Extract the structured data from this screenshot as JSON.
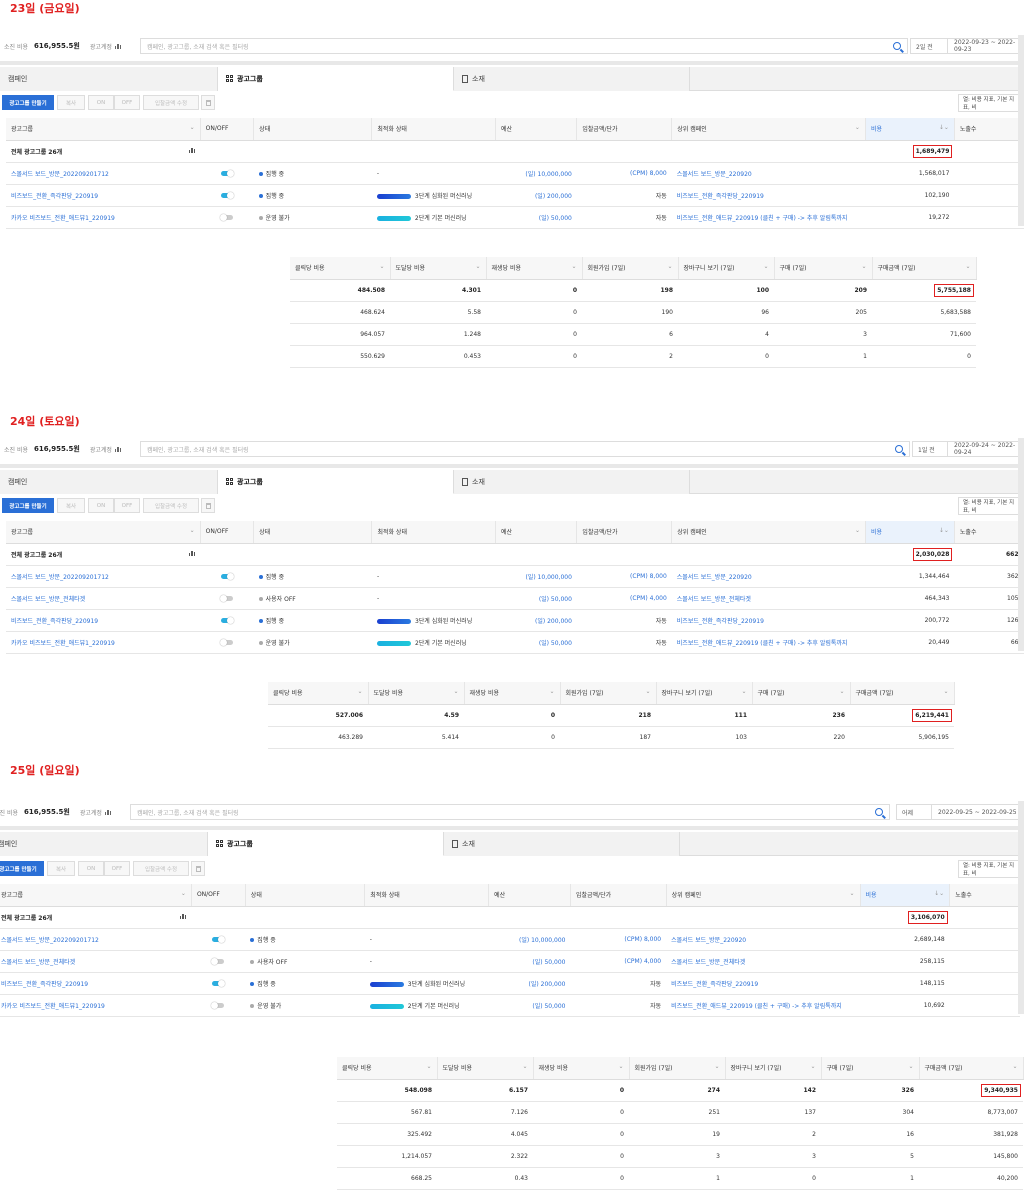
{
  "common": {
    "spent_label": "소진 비용",
    "spent_value": "616,955.5원",
    "account_label": "광고계정",
    "search_placeholder": "캠페인, 광고그룹, 소재 검색 혹은 필터링",
    "tabs": [
      "캠페인",
      "광고그룹",
      "소재"
    ],
    "toolbar": [
      "광고그룹 만들기",
      "복사",
      "ON",
      "OFF",
      "입찰금액 수정"
    ],
    "metric_btn": "열: 비용 지표, 기본 지표, 비",
    "columns": [
      "광고그룹",
      "ON/OFF",
      "상태",
      "최적화 상태",
      "예산",
      "입찰금액/단가",
      "상위 캠페인",
      "비용",
      "노출수"
    ],
    "sum_label": "전체 광고그룹 26개",
    "sub_columns": [
      "클릭당 비용",
      "도달당 비용",
      "재생당 비용",
      "회원가입 (7일)",
      "장바구니 보기 (7일)",
      "구매 (7일)",
      "구매금액 (7일)"
    ],
    "colors": {
      "accent": "#2a6fd6",
      "highlight": "#e02020"
    }
  },
  "days": [
    {
      "title": "23일 (금요일)",
      "date_sel": "2일 전",
      "date_range": "2022-09-23 ~ 2022-09-23",
      "sum_cost": "1,689,479",
      "sum_imp": "",
      "rows": [
        {
          "name": "스몰서드 보드_방문_202209201712",
          "toggle": "on",
          "status": "집행 중",
          "status_color": "blue",
          "opt": "-",
          "opt_bar": "",
          "budget": "(일) 10,000,000",
          "bid": "(CPM) 8,000",
          "campaign": "스몰서드 보드_방문_220920",
          "cost": "1,568,017",
          "imp": ""
        },
        {
          "name": "비즈보드_전환_즉각판당_220919",
          "toggle": "on",
          "status": "집행 중",
          "status_color": "blue",
          "opt": "3단계 심화된 머신러닝",
          "opt_bar": "p3",
          "budget": "(일) 200,000",
          "bid": "자동",
          "campaign": "비즈보드_전환_즉각판당_220919",
          "cost": "102,190",
          "imp": ""
        },
        {
          "name": "카카오 비즈보드_전환_애드뷰1_220919",
          "toggle": "off",
          "status": "운영 불가",
          "status_color": "gray",
          "opt": "2단계 기본 머신러닝",
          "opt_bar": "p2",
          "budget": "(일) 50,000",
          "bid": "자동",
          "campaign": "비즈보드_전환_애드뷰_220919 (클친 + 구매) -> 추후 알림톡까지",
          "cost": "19,272",
          "imp": ""
        }
      ],
      "sub_sum": [
        "484.508",
        "4.301",
        "0",
        "198",
        "100",
        "209",
        "5,755,188"
      ],
      "sub_rows": [
        [
          "468.624",
          "5.58",
          "0",
          "190",
          "96",
          "205",
          "5,683,588"
        ],
        [
          "964.057",
          "1.248",
          "0",
          "6",
          "4",
          "3",
          "71,600"
        ],
        [
          "550.629",
          "0.453",
          "0",
          "2",
          "0",
          "1",
          "0"
        ]
      ]
    },
    {
      "title": "24일 (토요일)",
      "date_sel": "1일 전",
      "date_range": "2022-09-24 ~ 2022-09-24",
      "sum_cost": "2,030,028",
      "sum_imp": "662",
      "rows": [
        {
          "name": "스몰서드 보드_방문_202209201712",
          "toggle": "on",
          "status": "집행 중",
          "status_color": "blue",
          "opt": "-",
          "opt_bar": "",
          "budget": "(일) 10,000,000",
          "bid": "(CPM) 8,000",
          "campaign": "스몰서드 보드_방문_220920",
          "cost": "1,344,464",
          "imp": "362"
        },
        {
          "name": "스몰서드 보드_방문_전체타겟",
          "toggle": "off",
          "status": "사용자 OFF",
          "status_color": "gray",
          "opt": "-",
          "opt_bar": "",
          "budget": "(일) 50,000",
          "bid": "(CPM) 4,000",
          "campaign": "스몰서드 보드_방문_전체타겟",
          "cost": "464,343",
          "imp": "105"
        },
        {
          "name": "비즈보드_전환_즉각판당_220919",
          "toggle": "on",
          "status": "집행 중",
          "status_color": "blue",
          "opt": "3단계 심화된 머신러닝",
          "opt_bar": "p3",
          "budget": "(일) 200,000",
          "bid": "자동",
          "campaign": "비즈보드_전환_즉각판당_220919",
          "cost": "200,772",
          "imp": "126"
        },
        {
          "name": "카카오 비즈보드_전환_애드뷰1_220919",
          "toggle": "off",
          "status": "운영 불가",
          "status_color": "gray",
          "opt": "2단계 기본 머신러닝",
          "opt_bar": "p2",
          "budget": "(일) 50,000",
          "bid": "자동",
          "campaign": "비즈보드_전환_애드뷰_220919 (클친 + 구매) -> 추후 알림톡까지",
          "cost": "20,449",
          "imp": "66"
        }
      ],
      "sub_sum": [
        "527.006",
        "4.59",
        "0",
        "218",
        "111",
        "236",
        "6,219,441"
      ],
      "sub_rows": [
        [
          "463.289",
          "5.414",
          "0",
          "187",
          "103",
          "220",
          "5,906,195"
        ]
      ]
    },
    {
      "title": "25일 (일요일)",
      "date_sel": "어제",
      "date_range": "2022-09-25 ~ 2022-09-25",
      "sum_cost": "3,106,070",
      "sum_imp": "",
      "rows": [
        {
          "name": "스몰서드 보드_방문_202209201712",
          "toggle": "on",
          "status": "집행 중",
          "status_color": "blue",
          "opt": "-",
          "opt_bar": "",
          "budget": "(일) 10,000,000",
          "bid": "(CPM) 8,000",
          "campaign": "스몰서드 보드_방문_220920",
          "cost": "2,689,148",
          "imp": ""
        },
        {
          "name": "스몰서드 보드_방문_전체타겟",
          "toggle": "off",
          "status": "사용자 OFF",
          "status_color": "gray",
          "opt": "-",
          "opt_bar": "",
          "budget": "(일) 50,000",
          "bid": "(CPM) 4,000",
          "campaign": "스몰서드 보드_방문_전체타겟",
          "cost": "258,115",
          "imp": ""
        },
        {
          "name": "비즈보드_전환_즉각판당_220919",
          "toggle": "on",
          "status": "집행 중",
          "status_color": "blue",
          "opt": "3단계 심화된 머신러닝",
          "opt_bar": "p3",
          "budget": "(일) 200,000",
          "bid": "자동",
          "campaign": "비즈보드_전환_즉각판당_220919",
          "cost": "148,115",
          "imp": ""
        },
        {
          "name": "카카오 비즈보드_전환_애드뷰1_220919",
          "toggle": "off",
          "status": "운영 불가",
          "status_color": "gray",
          "opt": "2단계 기본 머신러닝",
          "opt_bar": "p2",
          "budget": "(일) 50,000",
          "bid": "자동",
          "campaign": "비즈보드_전환_애드뷰_220919 (클친 + 구매) -> 추후 알림톡까지",
          "cost": "10,692",
          "imp": ""
        }
      ],
      "sub_sum": [
        "548.098",
        "6.157",
        "0",
        "274",
        "142",
        "326",
        "9,340,935"
      ],
      "sub_rows": [
        [
          "567.81",
          "7.126",
          "0",
          "251",
          "137",
          "304",
          "8,773,007"
        ],
        [
          "325.492",
          "4.045",
          "0",
          "19",
          "2",
          "16",
          "381,928"
        ],
        [
          "1,214.057",
          "2.322",
          "0",
          "3",
          "3",
          "5",
          "145,800"
        ],
        [
          "668.25",
          "0.43",
          "0",
          "1",
          "0",
          "1",
          "40,200"
        ]
      ]
    }
  ]
}
